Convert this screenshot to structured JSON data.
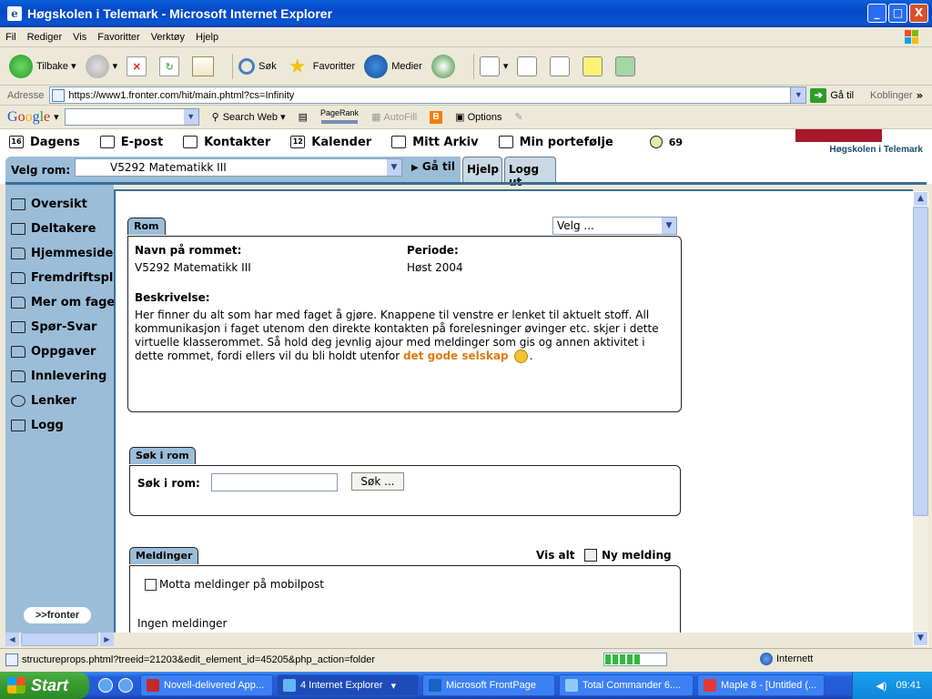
{
  "window": {
    "title": "Høgskolen i Telemark - Microsoft Internet Explorer",
    "buttons": [
      "_",
      "□",
      "X"
    ]
  },
  "menubar": [
    "Fil",
    "Rediger",
    "Vis",
    "Favoritter",
    "Verktøy",
    "Hjelp"
  ],
  "toolbar": {
    "back": "Tilbake",
    "search": "Søk",
    "favorites": "Favoritter",
    "media": "Medier"
  },
  "addressbar": {
    "label": "Adresse",
    "url": "https://www1.fronter.com/hit/main.phtml?cs=Infinity",
    "go": "Gå til",
    "links": "Koblinger"
  },
  "googlebar": {
    "logo": [
      "G",
      "o",
      "o",
      "g",
      "l",
      "e"
    ],
    "search_web": "Search Web",
    "pagerank": "PageRank",
    "autofill": "AutoFill",
    "options": "Options"
  },
  "fronter_nav": {
    "items": [
      "Dagens",
      "E-post",
      "Kontakter",
      "Kalender",
      "Mitt Arkiv",
      "Min portefølje"
    ],
    "online_count": "69",
    "school_name": "Høgskolen i Telemark"
  },
  "roombar": {
    "label": "Velg rom:",
    "selected_room": "V5292 Matematikk III",
    "goto": "Gå til",
    "help": "Hjelp",
    "logout": "Logg ut"
  },
  "sidebar": {
    "items": [
      "Oversikt",
      "Deltakere",
      "Hjemmeside",
      "Fremdriftsplan",
      "Mer om faget",
      "Spør-Svar",
      "Oppgaver",
      "Innlevering",
      "Lenker",
      "Logg"
    ],
    "logo": ">>fronter"
  },
  "room_panel": {
    "tab": "Rom",
    "velg": "Velg ...",
    "name_label": "Navn på rommet:",
    "name_value": "V5292 Matematikk III",
    "period_label": "Periode:",
    "period_value": "Høst 2004",
    "desc_label": "Beskrivelse:",
    "desc_text": "Her finner du alt som har med faget å gjøre. Knappene til venstre er lenket til aktuelt stoff. All kommunikasjon i faget utenom den direkte kontakten på forelesninger øvinger etc. skjer i dette virtuelle klasserommet. Så hold deg jevnlig ajour med meldinger som gis og annen aktivitet i dette rommet, fordi ellers vil du bli holdt utenfor",
    "desc_link": "det gode selskap",
    "desc_end": "."
  },
  "search_panel": {
    "tab": "Søk i rom",
    "label": "Søk i rom:",
    "button": "Søk ..."
  },
  "messages_panel": {
    "tab": "Meldinger",
    "view_all": "Vis alt",
    "new_message": "Ny melding",
    "mobile_checkbox": "Motta meldinger på mobilpost",
    "none": "Ingen meldinger"
  },
  "statusbar": {
    "text": "structureprops.phtml?treeid=21203&edit_element_id=45205&php_action=folder",
    "zone": "Internett"
  },
  "taskbar": {
    "start": "Start",
    "tasks": [
      "Novell-delivered App...",
      "4 Internet Explorer",
      "Microsoft FrontPage",
      "Total Commander 6....",
      "Maple 8 - [Untitled (..."
    ],
    "clock": "09:41"
  }
}
